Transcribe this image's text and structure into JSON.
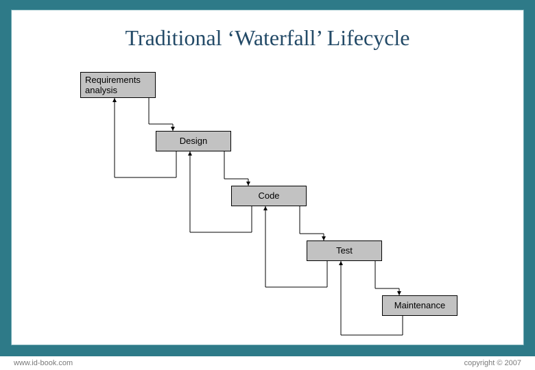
{
  "title": "Traditional ‘Waterfall’ Lifecycle",
  "boxes": {
    "b1": "Requirements\nanalysis",
    "b2": "Design",
    "b3": "Code",
    "b4": "Test",
    "b5": "Maintenance"
  },
  "footer": {
    "left": "www.id-book.com",
    "right": "copyright © 2007"
  },
  "colors": {
    "frame": "#2e7a88",
    "box_fill": "#c2c2c2",
    "title": "#234a67"
  }
}
